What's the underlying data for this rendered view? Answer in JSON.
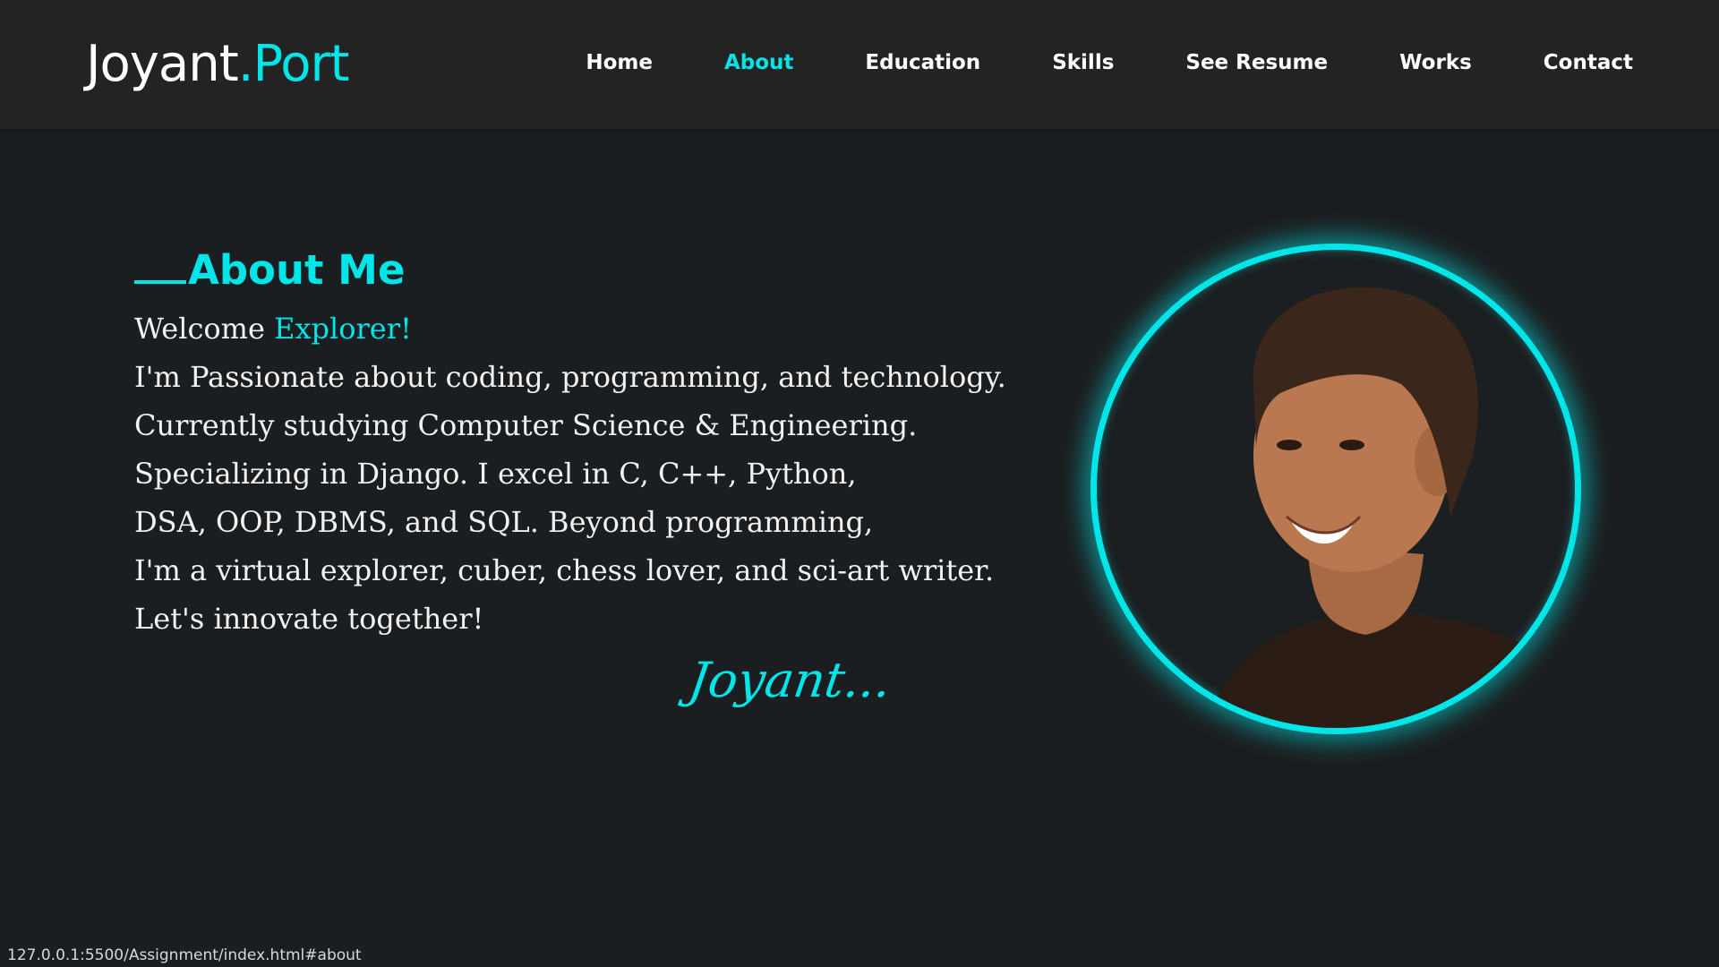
{
  "logo": {
    "name": "Joyant",
    "dot": ".",
    "suffix": "Port"
  },
  "nav": {
    "items": [
      {
        "label": "Home"
      },
      {
        "label": "About"
      },
      {
        "label": "Education"
      },
      {
        "label": "Skills"
      },
      {
        "label": "See Resume"
      },
      {
        "label": "Works"
      },
      {
        "label": "Contact"
      }
    ],
    "active": "About"
  },
  "about": {
    "title": "About Me",
    "greeting": "Welcome",
    "greeting_accent": "Explorer!",
    "lines": [
      "I'm Passionate about coding, programming, and technology.",
      "Currently studying Computer Science & Engineering.",
      "Specializing in Django. I excel in C, C++, Python,",
      "DSA, OOP, DBMS, and SQL. Beyond programming,",
      "I'm a virtual explorer, cuber, chess lover, and sci-art writer.",
      "Let's innovate together!"
    ],
    "signature": "Joyant..."
  },
  "status_bar": {
    "url": "127.0.0.1:5500/Assignment/index.html#about"
  },
  "colors": {
    "accent": "#00e5e8",
    "background": "#1b1e20",
    "navbar": "#232323"
  }
}
